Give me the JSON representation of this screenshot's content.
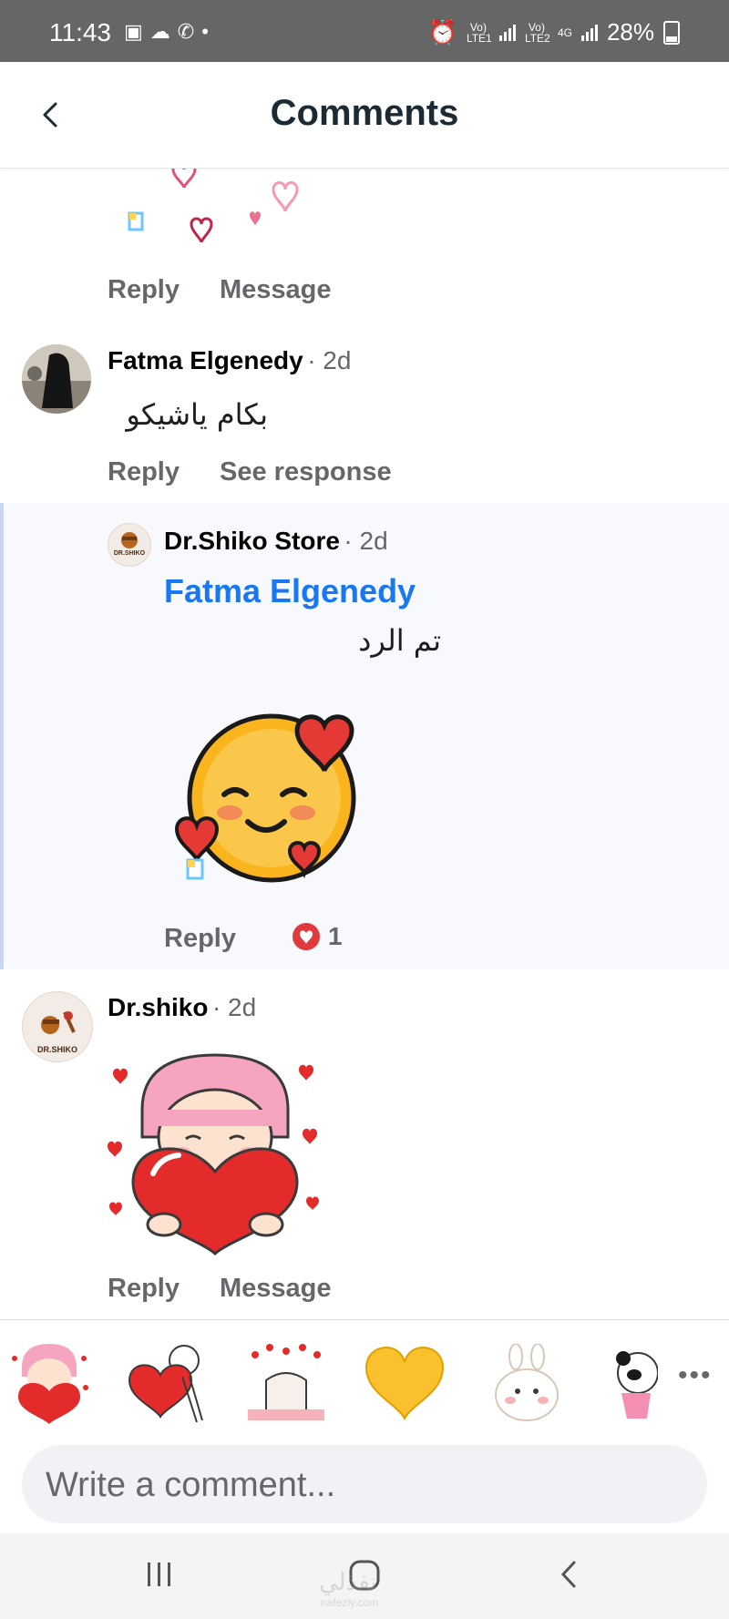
{
  "status_bar": {
    "time": "11:43",
    "battery": "28%",
    "sim1": "Vo) LTE1",
    "sim2": "Vo) LTE2",
    "network": "4G",
    "left_icons": [
      "image-icon",
      "cloud-icon",
      "whatsapp-icon",
      "dot-icon"
    ]
  },
  "header": {
    "title": "Comments",
    "back_icon": "chevron-left-icon"
  },
  "comments": [
    {
      "actions": [
        "Reply",
        "Message"
      ]
    },
    {
      "author": "Fatma Elgenedy",
      "time": "· 2d",
      "text": "بكام ياشيكو",
      "actions": [
        "Reply",
        "See response"
      ]
    },
    {
      "author": "Dr.Shiko Store",
      "time": "· 2d",
      "mention": "Fatma Elgenedy",
      "text": "تم الرد",
      "reply_action": "Reply",
      "reaction_count": "1",
      "avatar_text": "DR.SHIKO"
    },
    {
      "author": "Dr.shiko",
      "time": "· 2d",
      "actions": [
        "Reply",
        "Message"
      ],
      "avatar_text": "DR.SHIKO"
    }
  ],
  "sticker_tray": {
    "stickers": [
      "girl-heart-sticker",
      "heart-hug-sticker",
      "cat-hearts-sticker",
      "yellow-heart-sticker",
      "bunny-sticker",
      "panda-sticker"
    ],
    "more_icon": "more-horizontal-icon"
  },
  "composer": {
    "placeholder": "Write a comment..."
  },
  "watermark": {
    "main": "نفذلي",
    "sub": "nafezly.com"
  },
  "colors": {
    "link": "#1877f2",
    "secondary_text": "#65676b",
    "heart_red": "#e0393e",
    "emoji_yellow": "#f9b41e"
  }
}
